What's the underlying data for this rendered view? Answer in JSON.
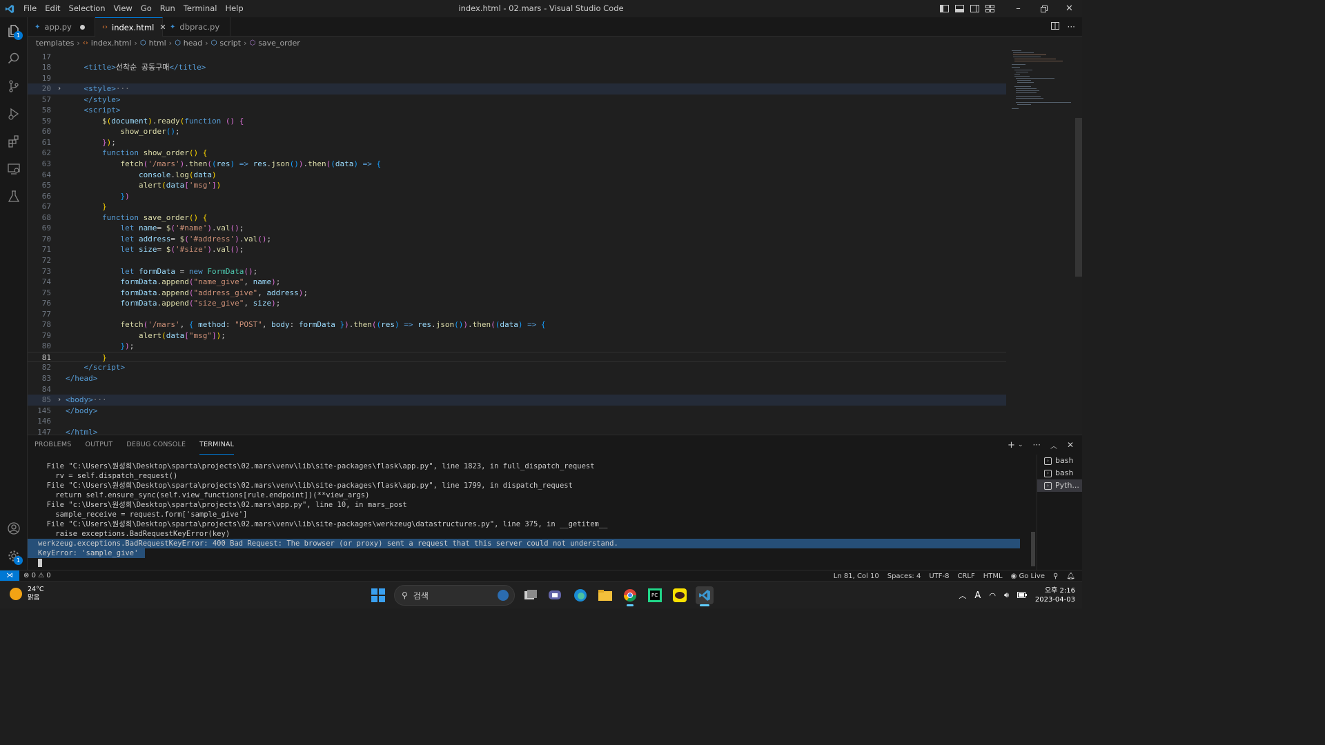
{
  "window": {
    "title": "index.html - 02.mars - Visual Studio Code",
    "menu": [
      "File",
      "Edit",
      "Selection",
      "View",
      "Go",
      "Run",
      "Terminal",
      "Help"
    ]
  },
  "activity_bar": {
    "explorer_badge": "1",
    "settings_badge": "1"
  },
  "tabs": [
    {
      "label": "app.py",
      "modified": true,
      "icon": "python-icon"
    },
    {
      "label": "index.html",
      "active": true,
      "icon": "html-icon"
    },
    {
      "label": "dbprac.py",
      "icon": "python-icon"
    }
  ],
  "breadcrumb": [
    "templates",
    "index.html",
    "html",
    "head",
    "script",
    "save_order"
  ],
  "editor": {
    "current_line": "81",
    "lines": [
      {
        "n": "17",
        "fold": "",
        "html": ""
      },
      {
        "n": "18",
        "fold": "",
        "html": "    <span class='c-tag'>&lt;title&gt;</span><span class='c-txt'>선착순 공동구매</span><span class='c-tag'>&lt;/title&gt;</span>"
      },
      {
        "n": "19",
        "fold": "",
        "html": ""
      },
      {
        "n": "20",
        "fold": "›",
        "hl": true,
        "html": "    <span class='c-tag'>&lt;style&gt;</span><span class='c-gray'>···</span>"
      },
      {
        "n": "57",
        "fold": "",
        "html": "    <span class='c-tag'>&lt;/style&gt;</span>"
      },
      {
        "n": "58",
        "fold": "",
        "html": "    <span class='c-tag'>&lt;script&gt;</span>"
      },
      {
        "n": "59",
        "fold": "",
        "html": "        <span class='c-fn'>$</span><span class='c-br1'>(</span><span class='c-var'>document</span><span class='c-br1'>)</span>.<span class='c-fn'>ready</span><span class='c-br1'>(</span><span class='c-kw'>function</span> <span class='c-br2'>()</span> <span class='c-br2'>{</span>"
      },
      {
        "n": "60",
        "fold": "",
        "html": "            <span class='c-fn'>show_order</span><span class='c-br3'>()</span>;"
      },
      {
        "n": "61",
        "fold": "",
        "html": "        <span class='c-br2'>}</span><span class='c-br1'>)</span>;"
      },
      {
        "n": "62",
        "fold": "",
        "html": "        <span class='c-kw'>function</span> <span class='c-fn'>show_order</span><span class='c-br1'>()</span> <span class='c-br1'>{</span>"
      },
      {
        "n": "63",
        "fold": "",
        "html": "            <span class='c-fn'>fetch</span><span class='c-br2'>(</span><span class='c-str'>'/mars'</span><span class='c-br2'>)</span>.<span class='c-fn'>then</span><span class='c-br2'>(</span><span class='c-br3'>(</span><span class='c-var'>res</span><span class='c-br3'>)</span> <span class='c-kw'>=&gt;</span> <span class='c-var'>res</span>.<span class='c-fn'>json</span><span class='c-br3'>()</span><span class='c-br2'>)</span>.<span class='c-fn'>then</span><span class='c-br2'>(</span><span class='c-br3'>(</span><span class='c-var'>data</span><span class='c-br3'>)</span> <span class='c-kw'>=&gt;</span> <span class='c-br3'>{</span>"
      },
      {
        "n": "64",
        "fold": "",
        "html": "                <span class='c-var'>console</span>.<span class='c-fn'>log</span><span class='c-br1'>(</span><span class='c-var'>data</span><span class='c-br1'>)</span>"
      },
      {
        "n": "65",
        "fold": "",
        "html": "                <span class='c-fn'>alert</span><span class='c-br1'>(</span><span class='c-var'>data</span><span class='c-br2'>[</span><span class='c-str'>'msg'</span><span class='c-br2'>]</span><span class='c-br1'>)</span>"
      },
      {
        "n": "66",
        "fold": "",
        "html": "            <span class='c-br3'>}</span><span class='c-br2'>)</span>"
      },
      {
        "n": "67",
        "fold": "",
        "html": "        <span class='c-br1'>}</span>"
      },
      {
        "n": "68",
        "fold": "",
        "html": "        <span class='c-kw'>function</span> <span class='c-fn'>save_order</span><span class='c-br1'>()</span> <span class='c-br1'>{</span>"
      },
      {
        "n": "69",
        "fold": "",
        "html": "            <span class='c-kw'>let</span> <span class='c-var'>name</span>= <span class='c-fn'>$</span><span class='c-br2'>(</span><span class='c-str'>'#name'</span><span class='c-br2'>)</span>.<span class='c-fn'>val</span><span class='c-br2'>()</span>;"
      },
      {
        "n": "70",
        "fold": "",
        "html": "            <span class='c-kw'>let</span> <span class='c-var'>address</span>= <span class='c-fn'>$</span><span class='c-br2'>(</span><span class='c-str'>'#address'</span><span class='c-br2'>)</span>.<span class='c-fn'>val</span><span class='c-br2'>()</span>;"
      },
      {
        "n": "71",
        "fold": "",
        "html": "            <span class='c-kw'>let</span> <span class='c-var'>size</span>= <span class='c-fn'>$</span><span class='c-br2'>(</span><span class='c-str'>'#size'</span><span class='c-br2'>)</span>.<span class='c-fn'>val</span><span class='c-br2'>()</span>;"
      },
      {
        "n": "72",
        "fold": "",
        "html": ""
      },
      {
        "n": "73",
        "fold": "",
        "html": "            <span class='c-kw'>let</span> <span class='c-var'>formData</span> = <span class='c-kw'>new</span> <span class='c-cls'>FormData</span><span class='c-br2'>()</span>;"
      },
      {
        "n": "74",
        "fold": "",
        "html": "            <span class='c-var'>formData</span>.<span class='c-fn'>append</span><span class='c-br2'>(</span><span class='c-str'>\"name_give\"</span>, <span class='c-var'>name</span><span class='c-br2'>)</span>;"
      },
      {
        "n": "75",
        "fold": "",
        "html": "            <span class='c-var'>formData</span>.<span class='c-fn'>append</span><span class='c-br2'>(</span><span class='c-str'>\"address_give\"</span>, <span class='c-var'>address</span><span class='c-br2'>)</span>;"
      },
      {
        "n": "76",
        "fold": "",
        "html": "            <span class='c-var'>formData</span>.<span class='c-fn'>append</span><span class='c-br2'>(</span><span class='c-str'>\"size_give\"</span>, <span class='c-var'>size</span><span class='c-br2'>)</span>;"
      },
      {
        "n": "77",
        "fold": "",
        "html": ""
      },
      {
        "n": "78",
        "fold": "",
        "html": "            <span class='c-fn'>fetch</span><span class='c-br2'>(</span><span class='c-str'>'/mars'</span>, <span class='c-br3'>{</span> <span class='c-var'>method</span>: <span class='c-str'>\"POST\"</span>, <span class='c-var'>body</span>: <span class='c-var'>formData</span> <span class='c-br3'>}</span><span class='c-br2'>)</span>.<span class='c-fn'>then</span><span class='c-br2'>(</span><span class='c-br3'>(</span><span class='c-var'>res</span><span class='c-br3'>)</span> <span class='c-kw'>=&gt;</span> <span class='c-var'>res</span>.<span class='c-fn'>json</span><span class='c-br3'>()</span><span class='c-br2'>)</span>.<span class='c-fn'>then</span><span class='c-br2'>(</span><span class='c-br3'>(</span><span class='c-var'>data</span><span class='c-br3'>)</span> <span class='c-kw'>=&gt;</span> <span class='c-br3'>{</span>"
      },
      {
        "n": "79",
        "fold": "",
        "html": "                <span class='c-fn'>alert</span><span class='c-br1'>(</span><span class='c-var'>data</span><span class='c-br2'>[</span><span class='c-str'>\"msg\"</span><span class='c-br2'>]</span><span class='c-br1'>)</span>;"
      },
      {
        "n": "80",
        "fold": "",
        "html": "            <span class='c-br3'>}</span><span class='c-br2'>)</span>;"
      },
      {
        "n": "81",
        "fold": "",
        "cur": true,
        "html": "        <span class='c-br1'>}</span>"
      },
      {
        "n": "82",
        "fold": "",
        "html": "    <span class='c-tag'>&lt;/script&gt;</span>"
      },
      {
        "n": "83",
        "fold": "",
        "html": "<span class='c-tag'>&lt;/head&gt;</span>"
      },
      {
        "n": "84",
        "fold": "",
        "html": ""
      },
      {
        "n": "85",
        "fold": "›",
        "hl": true,
        "html": "<span class='c-tag'>&lt;body&gt;</span><span class='c-gray'>···</span>"
      },
      {
        "n": "145",
        "fold": "",
        "html": "<span class='c-tag'>&lt;/body&gt;</span>"
      },
      {
        "n": "146",
        "fold": "",
        "html": ""
      },
      {
        "n": "147",
        "fold": "",
        "html": "<span class='c-tag'>&lt;/html&gt;</span>"
      }
    ]
  },
  "panel": {
    "tabs": [
      "PROBLEMS",
      "OUTPUT",
      "DEBUG CONSOLE",
      "TERMINAL"
    ],
    "active_tab": "TERMINAL",
    "terminal_lines": [
      {
        "text": "  File \"C:\\Users\\원성희\\Desktop\\sparta\\projects\\02.mars\\venv\\lib\\site-packages\\flask\\app.py\", line 1823, in full_dispatch_request"
      },
      {
        "text": "    rv = self.dispatch_request()"
      },
      {
        "text": "  File \"C:\\Users\\원성희\\Desktop\\sparta\\projects\\02.mars\\venv\\lib\\site-packages\\flask\\app.py\", line 1799, in dispatch_request"
      },
      {
        "text": "    return self.ensure_sync(self.view_functions[rule.endpoint])(**view_args)"
      },
      {
        "text": "  File \"c:\\Users\\원성희\\Desktop\\sparta\\projects\\02.mars\\app.py\", line 10, in mars_post"
      },
      {
        "text": "    sample_receive = request.form['sample_give']"
      },
      {
        "text": "  File \"C:\\Users\\원성희\\Desktop\\sparta\\projects\\02.mars\\venv\\lib\\site-packages\\werkzeug\\datastructures.py\", line 375, in __getitem__"
      },
      {
        "text": "    raise exceptions.BadRequestKeyError(key)"
      },
      {
        "text": "werkzeug.exceptions.BadRequestKeyError: 400 Bad Request: The browser (or proxy) sent a request that this server could not understand.",
        "selected": true
      },
      {
        "text": "KeyError: 'sample_give'",
        "selected": true,
        "short": true
      }
    ],
    "terminals": [
      "bash",
      "bash",
      "Pyth..."
    ]
  },
  "status_bar": {
    "errors": "0",
    "warnings": "0",
    "position": "Ln 81, Col 10",
    "spaces": "Spaces: 4",
    "encoding": "UTF-8",
    "eol": "CRLF",
    "language": "HTML",
    "go_live": "Go Live"
  },
  "taskbar": {
    "temperature": "24°C",
    "weather": "맑음",
    "search_placeholder": "검색",
    "time": "오후 2:16",
    "date": "2023-04-03",
    "ime": "A"
  }
}
